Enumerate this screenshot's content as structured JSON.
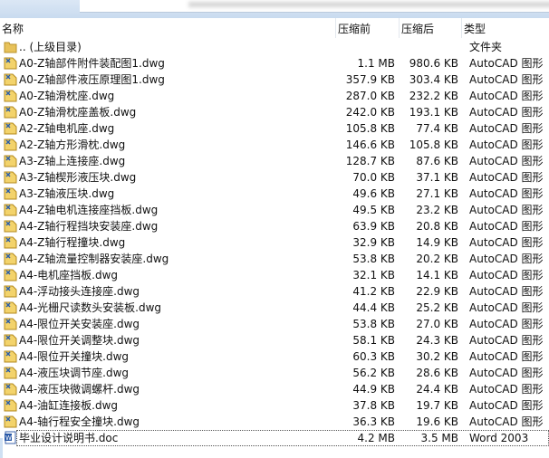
{
  "columns": {
    "name": "名称",
    "before": "压缩前",
    "after": "压缩后",
    "type": "类型"
  },
  "parent": {
    "name": ".. (上级目录)",
    "type": "文件夹",
    "icon": "folder-icon"
  },
  "files": [
    {
      "name": "A0-Z轴部件附件装配图1.dwg",
      "before": "1.1 MB",
      "after": "980.6 KB",
      "type": "AutoCAD 图形",
      "icon": "dwg-icon"
    },
    {
      "name": "A0-Z轴部件液压原理图1.dwg",
      "before": "357.9 KB",
      "after": "303.4 KB",
      "type": "AutoCAD 图形",
      "icon": "dwg-icon"
    },
    {
      "name": "A0-Z轴滑枕座.dwg",
      "before": "287.0 KB",
      "after": "232.2 KB",
      "type": "AutoCAD 图形",
      "icon": "dwg-icon"
    },
    {
      "name": "A0-Z轴滑枕座盖板.dwg",
      "before": "242.0 KB",
      "after": "193.1 KB",
      "type": "AutoCAD 图形",
      "icon": "dwg-icon"
    },
    {
      "name": "A2-Z轴电机座.dwg",
      "before": "105.8 KB",
      "after": "77.4 KB",
      "type": "AutoCAD 图形",
      "icon": "dwg-icon"
    },
    {
      "name": "A2-Z轴方形滑枕.dwg",
      "before": "146.6 KB",
      "after": "105.8 KB",
      "type": "AutoCAD 图形",
      "icon": "dwg-icon"
    },
    {
      "name": "A3-Z轴上连接座.dwg",
      "before": "128.7 KB",
      "after": "87.6 KB",
      "type": "AutoCAD 图形",
      "icon": "dwg-icon"
    },
    {
      "name": "A3-Z轴楔形液压块.dwg",
      "before": "70.0 KB",
      "after": "37.1 KB",
      "type": "AutoCAD 图形",
      "icon": "dwg-icon"
    },
    {
      "name": "A3-Z轴液压块.dwg",
      "before": "49.6 KB",
      "after": "27.1 KB",
      "type": "AutoCAD 图形",
      "icon": "dwg-icon"
    },
    {
      "name": "A4-Z轴电机连接座挡板.dwg",
      "before": "49.5 KB",
      "after": "23.2 KB",
      "type": "AutoCAD 图形",
      "icon": "dwg-icon"
    },
    {
      "name": "A4-Z轴行程挡块安装座.dwg",
      "before": "63.9 KB",
      "after": "20.8 KB",
      "type": "AutoCAD 图形",
      "icon": "dwg-icon"
    },
    {
      "name": "A4-Z轴行程撞块.dwg",
      "before": "32.9 KB",
      "after": "14.9 KB",
      "type": "AutoCAD 图形",
      "icon": "dwg-icon"
    },
    {
      "name": "A4-Z轴流量控制器安装座.dwg",
      "before": "53.8 KB",
      "after": "20.2 KB",
      "type": "AutoCAD 图形",
      "icon": "dwg-icon"
    },
    {
      "name": "A4-电机座挡板.dwg",
      "before": "32.1 KB",
      "after": "14.1 KB",
      "type": "AutoCAD 图形",
      "icon": "dwg-icon"
    },
    {
      "name": "A4-浮动接头连接座.dwg",
      "before": "41.2 KB",
      "after": "22.9 KB",
      "type": "AutoCAD 图形",
      "icon": "dwg-icon"
    },
    {
      "name": "A4-光栅尺读数头安装板.dwg",
      "before": "44.4 KB",
      "after": "25.2 KB",
      "type": "AutoCAD 图形",
      "icon": "dwg-icon"
    },
    {
      "name": "A4-限位开关安装座.dwg",
      "before": "53.8 KB",
      "after": "27.0 KB",
      "type": "AutoCAD 图形",
      "icon": "dwg-icon"
    },
    {
      "name": "A4-限位开关调整块.dwg",
      "before": "58.1 KB",
      "after": "24.3 KB",
      "type": "AutoCAD 图形",
      "icon": "dwg-icon"
    },
    {
      "name": "A4-限位开关撞块.dwg",
      "before": "60.3 KB",
      "after": "30.2 KB",
      "type": "AutoCAD 图形",
      "icon": "dwg-icon"
    },
    {
      "name": "A4-液压块调节座.dwg",
      "before": "56.2 KB",
      "after": "28.6 KB",
      "type": "AutoCAD 图形",
      "icon": "dwg-icon"
    },
    {
      "name": "A4-液压块微调螺杆.dwg",
      "before": "44.9 KB",
      "after": "24.4 KB",
      "type": "AutoCAD 图形",
      "icon": "dwg-icon"
    },
    {
      "name": "A4-油缸连接板.dwg",
      "before": "37.8 KB",
      "after": "19.7 KB",
      "type": "AutoCAD 图形",
      "icon": "dwg-icon"
    },
    {
      "name": "A4-轴行程安全撞块.dwg",
      "before": "36.3 KB",
      "after": "19.6 KB",
      "type": "AutoCAD 图形",
      "icon": "dwg-icon"
    },
    {
      "name": "毕业设计说明书.doc",
      "before": "4.2 MB",
      "after": "3.5 MB",
      "type": "Word 2003",
      "icon": "word-doc-icon"
    }
  ]
}
